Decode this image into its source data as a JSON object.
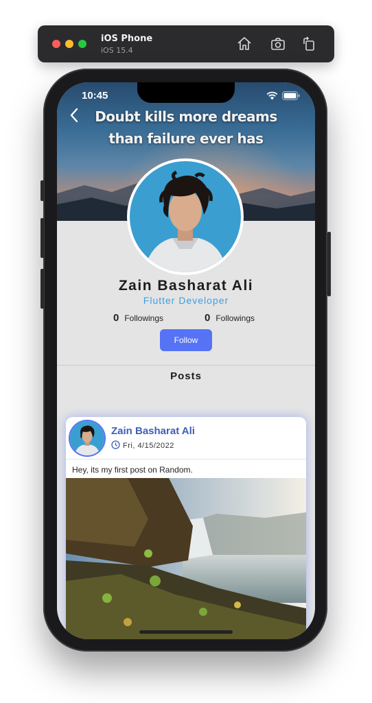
{
  "simulator": {
    "title": "iOS Phone",
    "subtitle": "iOS 15.4",
    "icons": [
      "home-icon",
      "screenshot-icon",
      "rotate-icon"
    ]
  },
  "status_bar": {
    "time": "10:45",
    "icons": [
      "wifi-icon",
      "battery-icon"
    ]
  },
  "header": {
    "back_icon": "chevron-left-icon",
    "quote_line1": "Doubt kills more dreams",
    "quote_line2": "than failure ever has"
  },
  "profile": {
    "name": "Zain Basharat Ali",
    "role": "Flutter Developer",
    "stats": [
      {
        "count": "0",
        "label": "Followings"
      },
      {
        "count": "0",
        "label": "Followings"
      }
    ],
    "follow_label": "Follow"
  },
  "posts_section": {
    "title": "Posts"
  },
  "post": {
    "author": "Zain Basharat Ali",
    "date": "Fri, 4/15/2022",
    "text": "Hey, its my first post on Random."
  },
  "colors": {
    "accent": "#5673f6",
    "role": "#3b9ee6",
    "author": "#3e5fb8",
    "page_bg": "#e4e4e4"
  }
}
